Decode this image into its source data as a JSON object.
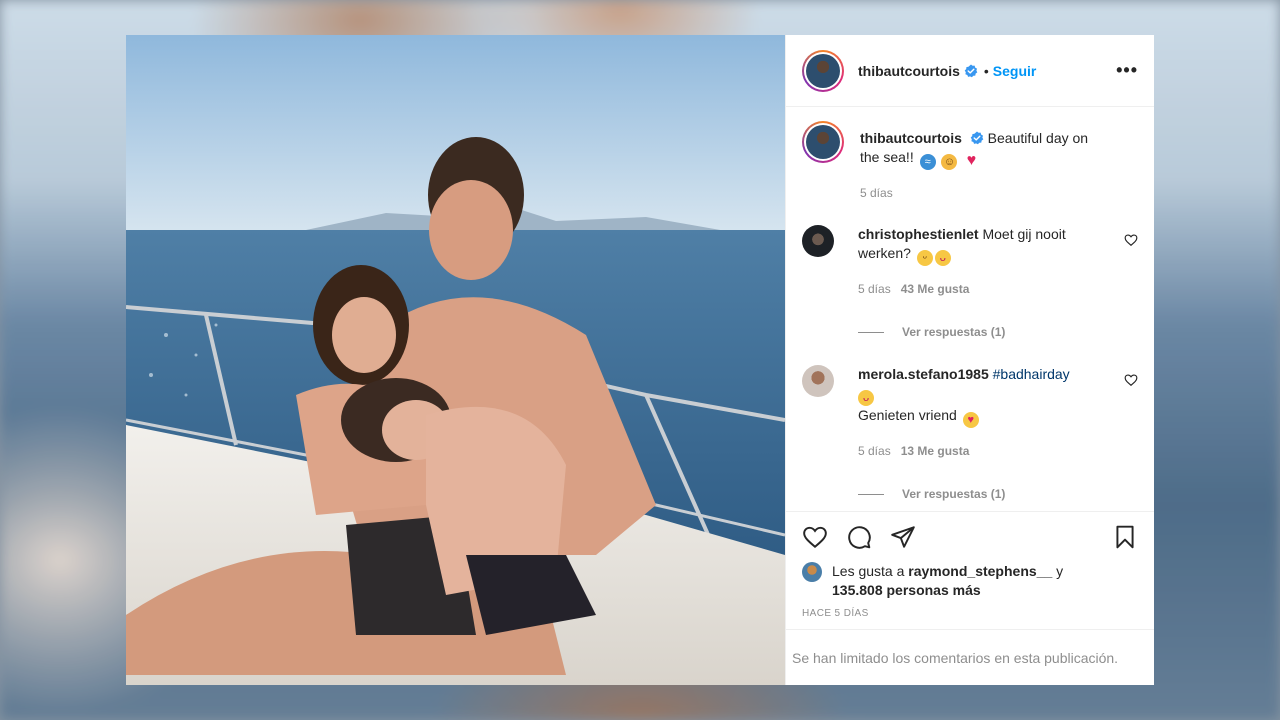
{
  "header": {
    "username": "thibautcourtois",
    "dot": "•",
    "follow_label": "Seguir",
    "more_label": "•••"
  },
  "caption": {
    "username": "thibautcourtois",
    "text_before": "Beautiful day on the sea!!",
    "time": "5 días"
  },
  "comments": [
    {
      "username": "christophestienlet",
      "text": "Moet gij nooit werken?",
      "time": "5 días",
      "likes": "43 Me gusta",
      "replies": "Ver respuestas (1)"
    },
    {
      "username": "merola.stefano1985",
      "hashtag": "#badhairday",
      "text": "Genieten vriend",
      "time": "5 días",
      "likes": "13 Me gusta",
      "replies": "Ver respuestas (1)"
    }
  ],
  "likes": {
    "prefix": "Les gusta a",
    "user": "raymond_stephens__",
    "connector": "y",
    "count": "135.808 personas más"
  },
  "posted_ago": "HACE 5 DÍAS",
  "comments_limited": "Se han limitado los comentarios en esta publicación.",
  "colors": {
    "follow": "#0095f6",
    "verified": "#3897f0",
    "muted": "#8e8e8e",
    "text": "#262626"
  },
  "icons": [
    "heart-icon",
    "comment-icon",
    "share-icon",
    "bookmark-icon",
    "verified-icon",
    "more-icon"
  ]
}
